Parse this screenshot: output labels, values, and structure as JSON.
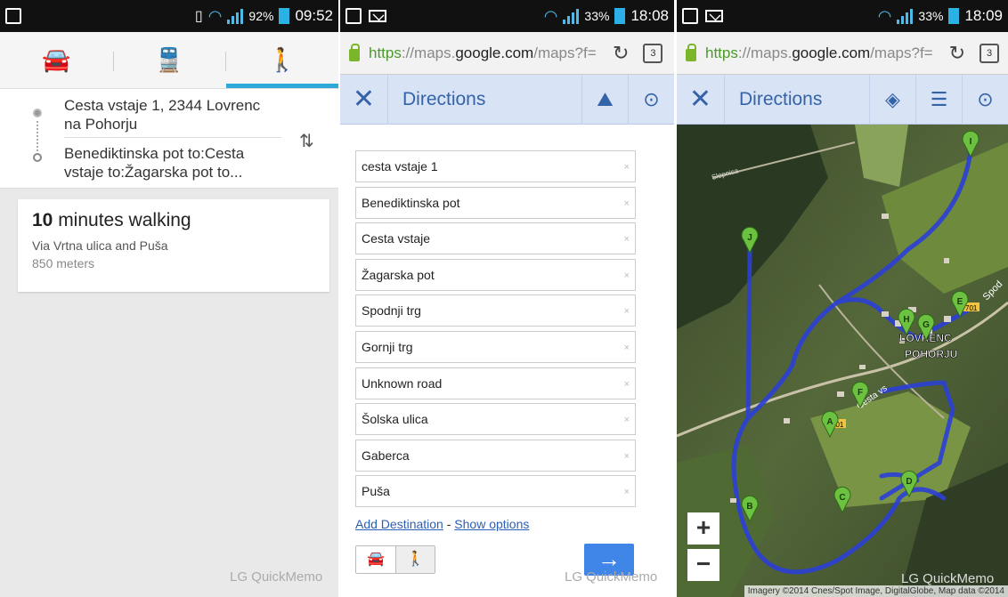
{
  "panel1": {
    "status": {
      "battery": "92%",
      "time": "09:52"
    },
    "modes": [
      "car-icon",
      "transit-icon",
      "walk-icon"
    ],
    "route": {
      "origin": "Cesta vstaje 1, 2344 Lovrenc na Pohorju",
      "destination": "Benediktinska pot to:Cesta vstaje to:Žagarska pot to..."
    },
    "result": {
      "minutes": "10",
      "title_suffix": " minutes walking",
      "via": "Via Vrtna ulica and Puša",
      "distance": "850 meters"
    },
    "watermark": "LG QuickMemo"
  },
  "panel2": {
    "status": {
      "battery": "33%",
      "time": "18:08"
    },
    "url": {
      "scheme": "https",
      "pre": "://maps.",
      "domain": "google.com",
      "path": "/maps?f=",
      "tabs": "3"
    },
    "title": "Directions",
    "destinations": [
      "cesta vstaje 1",
      "Benediktinska pot",
      "Cesta vstaje",
      "Žagarska pot",
      "Spodnji trg",
      "Gornji trg",
      "Unknown road",
      "Šolska ulica",
      "Gaberca",
      "Puša"
    ],
    "clear_glyph": "×",
    "add_destination": "Add Destination",
    "separator": " - ",
    "show_options": "Show options",
    "go_glyph": "→",
    "watermark": "LG QuickMemo"
  },
  "panel3": {
    "status": {
      "battery": "33%",
      "time": "18:09"
    },
    "url": {
      "scheme": "https",
      "pre": "://maps.",
      "domain": "google.com",
      "path": "/maps?f=",
      "tabs": "3"
    },
    "title": "Directions",
    "town_line1": "LOVRENC",
    "town_line2": "POHORJU",
    "road_label": "Cesta vs",
    "small_label": "Slepnica",
    "right_label": "Spod",
    "markers": [
      "A",
      "B",
      "C",
      "D",
      "E",
      "F",
      "G",
      "H",
      "I",
      "J"
    ],
    "road_badges": [
      "701",
      "701"
    ],
    "zoom_in": "+",
    "zoom_out": "−",
    "watermark": "LG QuickMemo",
    "attribution": "Imagery ©2014 Cnes/Spot Image, DigitalGlobe, Map data ©2014"
  },
  "colors": {
    "accent": "#2ea8d9",
    "route": "#2b3fd6",
    "marker": "#6cc240",
    "link": "#2b5fb5",
    "appbar": "#d8e3f6"
  }
}
